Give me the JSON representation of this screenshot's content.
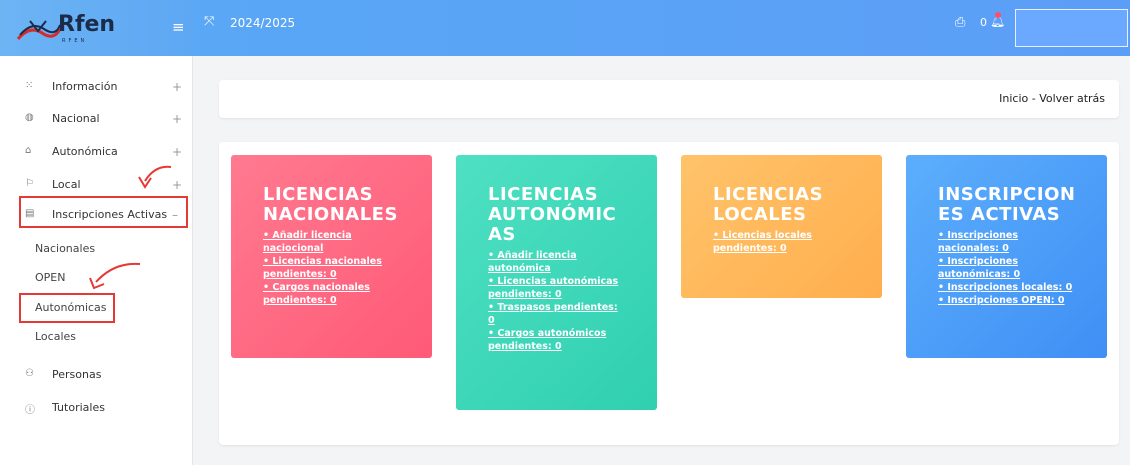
{
  "header": {
    "logo": "Rfen",
    "logo_sub": "RFEN",
    "menu_icon": "hamburger-icon",
    "season": "2024/2025",
    "notification_count": "0"
  },
  "sidebar": {
    "items": [
      {
        "label": "Información",
        "icon": "grid-icon",
        "expand": "+"
      },
      {
        "label": "Nacional",
        "icon": "globe-icon",
        "expand": "+"
      },
      {
        "label": "Autonómica",
        "icon": "home-icon",
        "expand": "+"
      },
      {
        "label": "Local",
        "icon": "flag-icon",
        "expand": "+"
      },
      {
        "label": "Inscripciones Activas",
        "icon": "document-icon",
        "expand": "–"
      },
      {
        "label": "Personas",
        "icon": "people-icon"
      },
      {
        "label": "Tutoriales",
        "icon": "info-icon"
      }
    ],
    "subitems": [
      "Nacionales",
      "OPEN",
      "Autonómicas",
      "Locales"
    ]
  },
  "breadcrumb": "Inicio - Volver atrás",
  "tiles": [
    {
      "title": "LICENCIAS NACIONALES",
      "color": "#ff6680",
      "lines": [
        "• Añadir licencia",
        "naciocional",
        "• Licencias nacionales",
        "pendientes: 0",
        "• Cargos nacionales",
        "pendientes: 0"
      ]
    },
    {
      "title": "LICENCIAS AUTONÓMIC AS",
      "color": "#3fd8b9",
      "lines": [
        "• Añadir licencia",
        "autonómica",
        "• Licencias autonómicas",
        "pendientes: 0",
        "• Traspasos pendientes:",
        "0",
        "• Cargos autonómicos",
        "pendientes: 0"
      ]
    },
    {
      "title": "LICENCIAS LOCALES",
      "color": "#ffb95c",
      "lines": [
        "• Licencias locales",
        "pendientes: 0"
      ]
    },
    {
      "title": "INSCRIPCION ES ACTIVAS",
      "color": "#4d9ef8",
      "lines": [
        "• Inscripciones",
        "nacionales: 0",
        "• Inscripciones",
        "autonómicas: 0",
        "• Inscripciones locales: 0",
        "• Inscripciones OPEN: 0"
      ]
    }
  ]
}
